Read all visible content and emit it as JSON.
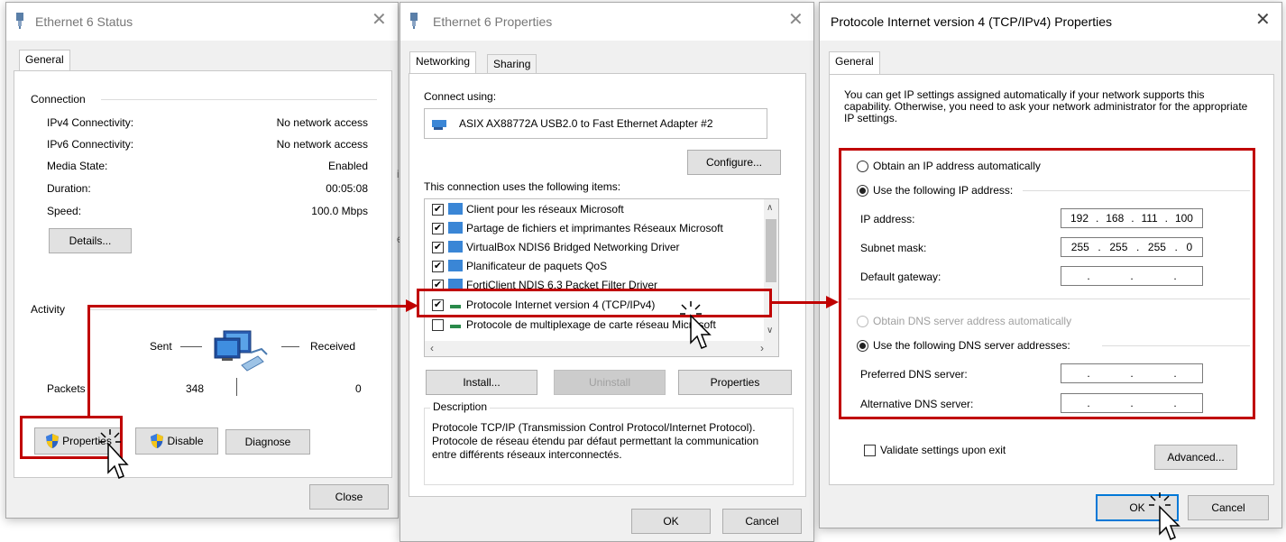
{
  "status_window": {
    "title": "Ethernet 6 Status",
    "tab_general": "General",
    "connection_heading": "Connection",
    "rows": [
      {
        "label": "IPv4 Connectivity:",
        "value": "No network access"
      },
      {
        "label": "IPv6 Connectivity:",
        "value": "No network access"
      },
      {
        "label": "Media State:",
        "value": "Enabled"
      },
      {
        "label": "Duration:",
        "value": "00:05:08"
      },
      {
        "label": "Speed:",
        "value": "100.0 Mbps"
      }
    ],
    "details_label": "Details...",
    "activity_heading": "Activity",
    "sent_label": "Sent",
    "received_label": "Received",
    "packets_label": "Packets",
    "packets_sent": "348",
    "packets_received": "0",
    "properties_label": "Properties",
    "disable_label": "Disable",
    "diagnose_label": "Diagnose",
    "close_label": "Close"
  },
  "properties_window": {
    "title": "Ethernet 6 Properties",
    "tab_networking": "Networking",
    "tab_sharing": "Sharing",
    "connect_using_label": "Connect using:",
    "adapter_name": "ASIX AX88772A USB2.0 to Fast Ethernet Adapter #2",
    "configure_label": "Configure...",
    "items_label": "This connection uses the following items:",
    "items": [
      {
        "label": "Client pour les réseaux Microsoft",
        "checked": true
      },
      {
        "label": "Partage de fichiers et imprimantes Réseaux Microsoft",
        "checked": true
      },
      {
        "label": "VirtualBox NDIS6 Bridged Networking Driver",
        "checked": true
      },
      {
        "label": "Planificateur de paquets QoS",
        "checked": true
      },
      {
        "label": "FortiClient NDIS 6.3 Packet Filter Driver",
        "checked": true
      },
      {
        "label": "Protocole Internet version 4 (TCP/IPv4)",
        "checked": true
      },
      {
        "label": "Protocole de multiplexage de carte réseau Microsoft",
        "checked": false
      }
    ],
    "install_label": "Install...",
    "uninstall_label": "Uninstall",
    "properties_label": "Properties",
    "description_heading": "Description",
    "description_text": "Protocole TCP/IP (Transmission Control Protocol/Internet Protocol). Protocole de réseau étendu par défaut permettant la communication entre différents réseaux interconnectés.",
    "ok_label": "OK",
    "cancel_label": "Cancel"
  },
  "ipv4_window": {
    "title": "Protocole Internet version 4 (TCP/IPv4) Properties",
    "tab_general": "General",
    "intro_text": "You can get IP settings assigned automatically if your network supports this capability. Otherwise, you need to ask your network administrator for the appropriate IP settings.",
    "obtain_ip_auto": "Obtain an IP address automatically",
    "use_following_ip": "Use the following IP address:",
    "ip_address_label": "IP address:",
    "ip_address": [
      "192",
      "168",
      "111",
      "100"
    ],
    "subnet_label": "Subnet mask:",
    "subnet_mask": [
      "255",
      "255",
      "255",
      "0"
    ],
    "gateway_label": "Default gateway:",
    "obtain_dns_auto": "Obtain DNS server address automatically",
    "use_following_dns": "Use the following DNS server addresses:",
    "preferred_dns_label": "Preferred DNS server:",
    "alternative_dns_label": "Alternative DNS server:",
    "validate_label": "Validate settings upon exit",
    "advanced_label": "Advanced...",
    "ok_label": "OK",
    "cancel_label": "Cancel"
  },
  "colors": {
    "highlight_red": "#c00000",
    "focus_blue": "#0078d7"
  }
}
